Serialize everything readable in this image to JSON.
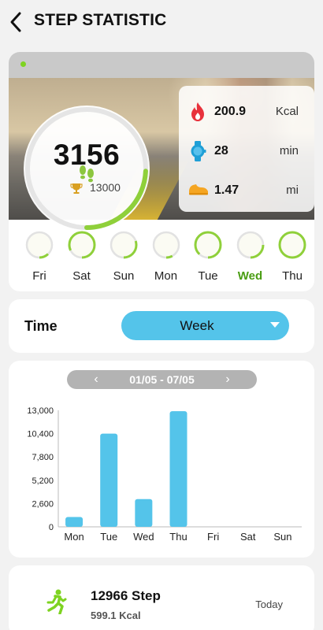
{
  "header": {
    "title": "STEP STATISTIC",
    "back_icon": "chevron-left-icon"
  },
  "today": {
    "steps": "3156",
    "goal": "13000",
    "progress_fraction": 0.243,
    "stats": [
      {
        "icon": "flame-icon",
        "value": "200.9",
        "unit": "Kcal",
        "color": "#e8323c"
      },
      {
        "icon": "watch-icon",
        "value": "28",
        "unit": "min",
        "color": "#1e9fd6"
      },
      {
        "icon": "shoe-icon",
        "value": "1.47",
        "unit": "mi",
        "color": "#f5a623"
      }
    ]
  },
  "week_days": [
    {
      "label": "Fri",
      "progress": 0.12,
      "active": false
    },
    {
      "label": "Sat",
      "progress": 0.82,
      "active": false
    },
    {
      "label": "Sun",
      "progress": 0.3,
      "active": false
    },
    {
      "label": "Mon",
      "progress": 0.08,
      "active": false
    },
    {
      "label": "Tue",
      "progress": 0.88,
      "active": false
    },
    {
      "label": "Wed",
      "progress": 0.25,
      "active": true
    },
    {
      "label": "Thu",
      "progress": 1.0,
      "active": false
    }
  ],
  "time_filter": {
    "label": "Time",
    "selected": "Week"
  },
  "range": {
    "text": "01/05 - 07/05",
    "prev": "‹",
    "next": "›"
  },
  "chart_data": {
    "type": "bar",
    "categories": [
      "Mon",
      "Tue",
      "Wed",
      "Thu",
      "Fri",
      "Sat",
      "Sun"
    ],
    "values": [
      1100,
      10400,
      3100,
      12900,
      0,
      0,
      0
    ],
    "ylim": [
      0,
      13000
    ],
    "yticks": [
      0,
      2600,
      5200,
      7800,
      10400,
      13000
    ],
    "ytick_labels": [
      "0",
      "2,600",
      "5,200",
      "7,800",
      "10,400",
      "13,000"
    ],
    "bar_color": "#54c4ea"
  },
  "summary": {
    "steps": "12966  Step",
    "kcal": "599.1 Kcal",
    "date": "Today"
  },
  "colors": {
    "accent_green": "#7ed321",
    "accent_blue": "#54c4ea",
    "active_day": "#4a9d13"
  }
}
